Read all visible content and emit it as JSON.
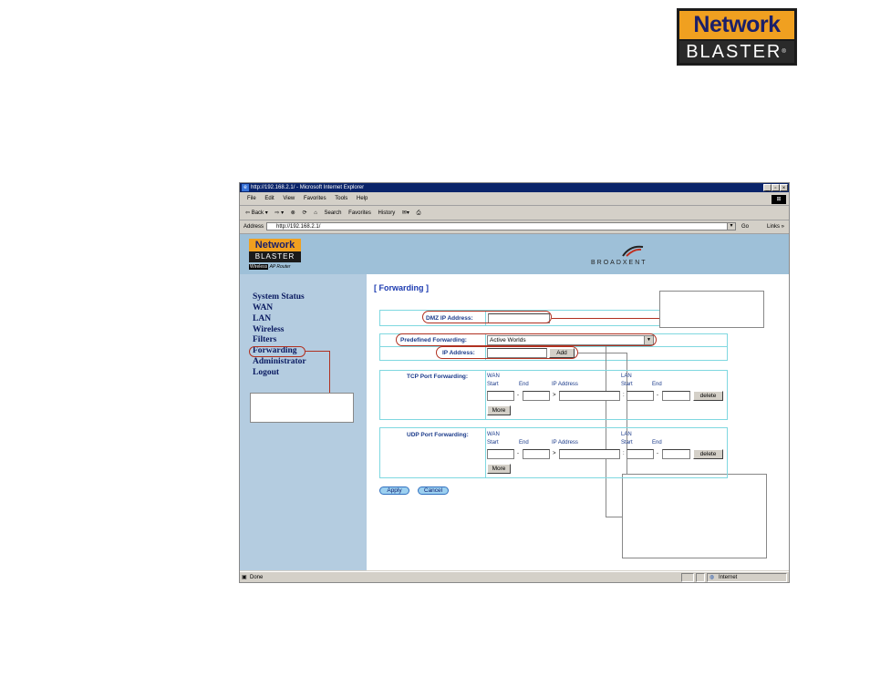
{
  "logo": {
    "line1": "Network",
    "line2": "BLASTER",
    "reg": "®"
  },
  "browser": {
    "title": "http://192.168.2.1/ - Microsoft Internet Explorer",
    "window_buttons": [
      "_",
      "▫",
      "×"
    ],
    "menu": [
      "File",
      "Edit",
      "View",
      "Favorites",
      "Tools",
      "Help"
    ],
    "toolbar": [
      "⇦ Back ▾",
      "⇨ ▾",
      "⊗",
      "⟳",
      "⌂",
      "Search",
      "Favorites",
      "History",
      "✉▾",
      "⎙"
    ],
    "address_label": "Address",
    "address": "http://192.168.2.1/",
    "go": "Go",
    "links": "Links »",
    "status": "Done",
    "zone": "Internet"
  },
  "router": {
    "logo_line1": "Network",
    "logo_line2": "BLASTER",
    "logo_wireless": "Wireless",
    "logo_sub": "AP Router",
    "brand": "BROADXENT"
  },
  "nav": [
    "System Status",
    "WAN",
    "LAN",
    "Wireless",
    "Filters",
    "Forwarding",
    "Administrator",
    "Logout"
  ],
  "forwarding": {
    "title": "[ Forwarding ]",
    "dmz_label": "DMZ IP Address:",
    "dmz_value": "",
    "predef_label": "Predefined Forwarding:",
    "predef_value": "Active Worlds",
    "ip_label": "IP Address:",
    "ip_value": "",
    "add": "Add",
    "tcp_label": "TCP Port Forwarding:",
    "udp_label": "UDP Port Forwarding:",
    "wan": "WAN",
    "lan": "LAN",
    "start": "Start",
    "end": "End",
    "ip_address": "IP Address",
    "dash": "-",
    "arrow": ">",
    "colon": ":",
    "delete": "delete",
    "more": "More",
    "apply": "Apply",
    "cancel": "Cancel"
  }
}
